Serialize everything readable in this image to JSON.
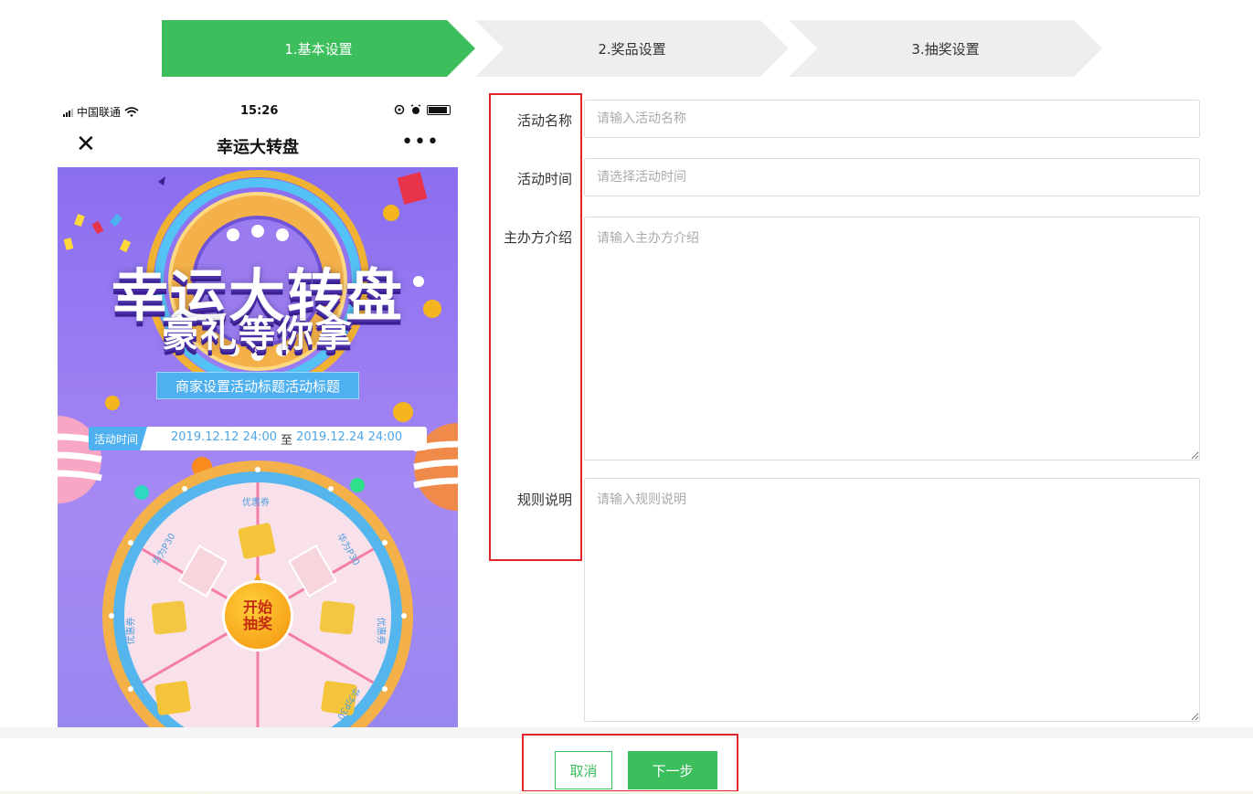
{
  "steps": [
    {
      "label": "1.基本设置",
      "active": true
    },
    {
      "label": "2.奖品设置",
      "active": false
    },
    {
      "label": "3.抽奖设置",
      "active": false
    }
  ],
  "phone": {
    "status": {
      "carrier": "中国联通",
      "time": "15:26"
    },
    "nav": {
      "close_symbol": "✕",
      "title": "幸运大转盘",
      "more_symbol": "•••"
    },
    "poster": {
      "headline": "幸运大转盘",
      "subheadline": "豪礼等你拿",
      "activity_title": "商家设置活动标题活动标题",
      "time_tag": "活动时间",
      "time_start": "2019.12.12 24:00",
      "time_separator": "至",
      "time_end": "2019.12.24 24:00",
      "wheel": {
        "start_button": "开始抽奖",
        "segments": [
          "优惠券",
          "华为P30",
          "优惠券",
          "华为P30",
          "优惠券",
          "华为P30"
        ]
      }
    }
  },
  "form": {
    "name": {
      "label": "活动名称",
      "placeholder": "请输入活动名称",
      "value": ""
    },
    "time": {
      "label": "活动时间",
      "placeholder": "请选择活动时间",
      "value": ""
    },
    "organizer": {
      "label": "主办方介绍",
      "placeholder": "请输入主办方介绍",
      "value": ""
    },
    "rules": {
      "label": "规则说明",
      "placeholder": "请输入规则说明",
      "value": ""
    }
  },
  "footer": {
    "cancel_label": "取消",
    "next_label": "下一步"
  },
  "colors": {
    "primary": "#3dbe5d",
    "step_inactive": "#eeeeee",
    "highlight": "#e0252b",
    "poster_bg": "#9a7cf2"
  }
}
